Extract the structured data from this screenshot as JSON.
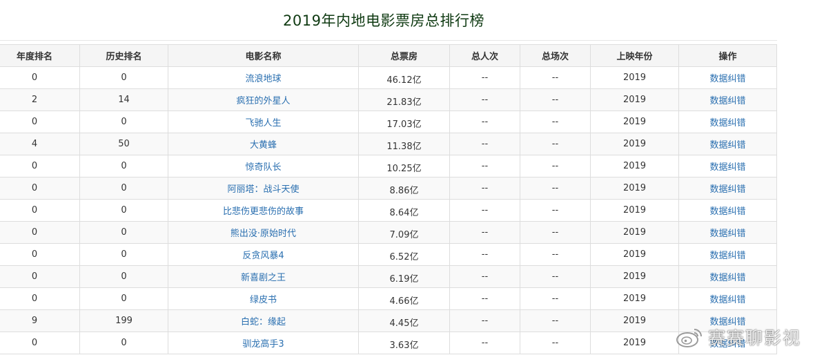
{
  "page": {
    "title": "2019年内地电影票房总排行榜"
  },
  "table": {
    "headers": {
      "year_rank": "年度排名",
      "hist_rank": "历史排名",
      "name": "电影名称",
      "gross": "总票房",
      "admissions": "总人次",
      "shows": "总场次",
      "year": "上映年份",
      "action": "操作"
    },
    "rows": [
      {
        "year_rank": "0",
        "hist_rank": "0",
        "name": "流浪地球",
        "gross": "46.12",
        "unit": "亿",
        "admissions": "--",
        "shows": "--",
        "year": "2019",
        "action": "数据纠错"
      },
      {
        "year_rank": "2",
        "hist_rank": "14",
        "name": "疯狂的外星人",
        "gross": "21.83",
        "unit": "亿",
        "admissions": "--",
        "shows": "--",
        "year": "2019",
        "action": "数据纠错"
      },
      {
        "year_rank": "0",
        "hist_rank": "0",
        "name": "飞驰人生",
        "gross": "17.03",
        "unit": "亿",
        "admissions": "--",
        "shows": "--",
        "year": "2019",
        "action": "数据纠错"
      },
      {
        "year_rank": "4",
        "hist_rank": "50",
        "name": "大黄蜂",
        "gross": "11.38",
        "unit": "亿",
        "admissions": "--",
        "shows": "--",
        "year": "2019",
        "action": "数据纠错"
      },
      {
        "year_rank": "0",
        "hist_rank": "0",
        "name": "惊奇队长",
        "gross": "10.25",
        "unit": "亿",
        "admissions": "--",
        "shows": "--",
        "year": "2019",
        "action": "数据纠错"
      },
      {
        "year_rank": "0",
        "hist_rank": "0",
        "name": "阿丽塔：战斗天使",
        "gross": "8.86",
        "unit": "亿",
        "admissions": "--",
        "shows": "--",
        "year": "2019",
        "action": "数据纠错"
      },
      {
        "year_rank": "0",
        "hist_rank": "0",
        "name": "比悲伤更悲伤的故事",
        "gross": "8.64",
        "unit": "亿",
        "admissions": "--",
        "shows": "--",
        "year": "2019",
        "action": "数据纠错"
      },
      {
        "year_rank": "0",
        "hist_rank": "0",
        "name": "熊出没·原始时代",
        "gross": "7.09",
        "unit": "亿",
        "admissions": "--",
        "shows": "--",
        "year": "2019",
        "action": "数据纠错"
      },
      {
        "year_rank": "0",
        "hist_rank": "0",
        "name": "反贪风暴4",
        "gross": "6.52",
        "unit": "亿",
        "admissions": "--",
        "shows": "--",
        "year": "2019",
        "action": "数据纠错"
      },
      {
        "year_rank": "0",
        "hist_rank": "0",
        "name": "新喜剧之王",
        "gross": "6.19",
        "unit": "亿",
        "admissions": "--",
        "shows": "--",
        "year": "2019",
        "action": "数据纠错"
      },
      {
        "year_rank": "0",
        "hist_rank": "0",
        "name": "绿皮书",
        "gross": "4.66",
        "unit": "亿",
        "admissions": "--",
        "shows": "--",
        "year": "2019",
        "action": "数据纠错"
      },
      {
        "year_rank": "9",
        "hist_rank": "199",
        "name": "白蛇：缘起",
        "gross": "4.45",
        "unit": "亿",
        "admissions": "--",
        "shows": "--",
        "year": "2019",
        "action": "数据纠错"
      },
      {
        "year_rank": "0",
        "hist_rank": "0",
        "name": "驯龙高手3",
        "gross": "3.63",
        "unit": "亿",
        "admissions": "--",
        "shows": "--",
        "year": "2019",
        "action": "数据纠错"
      }
    ]
  },
  "watermark": {
    "text": "赛赛聊影视",
    "icon": "weibo-logo-icon"
  }
}
